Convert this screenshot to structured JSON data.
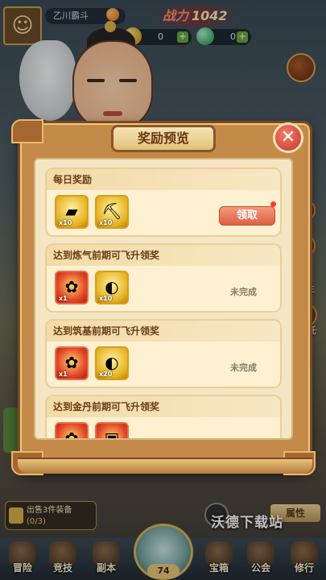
{
  "hud": {
    "player_name": "乙川霸斗",
    "power_label": "战力",
    "power_value": "1042",
    "gold": "0",
    "jade": "0"
  },
  "modal": {
    "title": "奖励预览",
    "close_glyph": "✕",
    "rewards": [
      {
        "title": "每日奖励",
        "items": [
          {
            "icon": "gold-ingot-icon",
            "qty": "x10"
          },
          {
            "icon": "axe-icon",
            "qty": "x10"
          }
        ],
        "action": "领取"
      },
      {
        "title": "达到炼气前期可飞升领奖",
        "items": [
          {
            "icon": "red-lotus-icon",
            "qty": "x1"
          },
          {
            "icon": "gold-pouch-icon",
            "qty": "x10"
          }
        ],
        "status": "未完成"
      },
      {
        "title": "达到筑基前期可飞升领奖",
        "items": [
          {
            "icon": "red-lotus-icon",
            "qty": "x1"
          },
          {
            "icon": "gold-pouch-icon",
            "qty": "x20"
          }
        ],
        "status": "未完成"
      },
      {
        "title": "达到金丹前期可飞升领奖",
        "items": [
          {
            "icon": "red-lotus-icon",
            "qty": ""
          },
          {
            "icon": "red-chest-icon",
            "qty": ""
          }
        ],
        "status": ""
      }
    ]
  },
  "side": {
    "right_label_1": "性",
    "right_label_2": "托"
  },
  "quest": {
    "text": "出售3件装备",
    "progress": "(0/3)"
  },
  "attr_button": "属性",
  "nav": {
    "items": [
      "冒险",
      "竞技",
      "副本",
      "宝箱",
      "公会",
      "修行"
    ],
    "center_count": "74"
  },
  "watermark": "沃德下载站",
  "colors": {
    "modal_frame": "#c48a4a",
    "modal_inner": "#f4e6c4",
    "claim_button": "#de5f41",
    "title_text": "#6a3614"
  }
}
